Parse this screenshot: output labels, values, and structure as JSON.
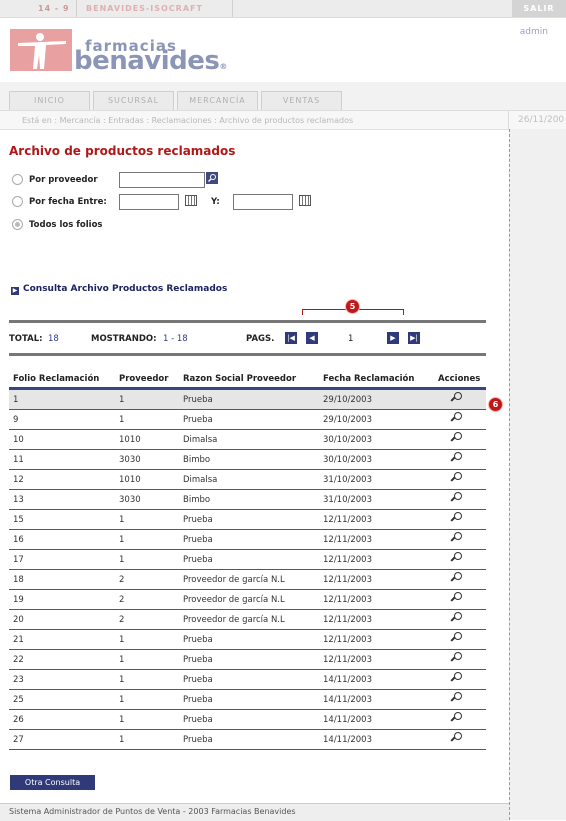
{
  "topbar": {
    "code": "14 - 9",
    "app_name": "BENAVIDES-ISOCRAFT",
    "logout": "SALIR"
  },
  "header": {
    "logo_small": "farmacias",
    "logo_big": "benavides",
    "logo_mark": "®",
    "user": "admin"
  },
  "nav": {
    "tabs": [
      "INICIO",
      "SUCURSAL",
      "MERCANCÍA",
      "VENTAS"
    ]
  },
  "breadcrumb": {
    "text": "Está en : Mercancía : Entradas : Reclamaciones : Archivo de productos reclamados",
    "date": "26/11/200"
  },
  "page": {
    "title": "Archivo de productos reclamados"
  },
  "filters": {
    "by_provider": "Por proveedor",
    "by_date": "Por fecha Entre:",
    "y_label": "Y:",
    "all": "Todos los folios",
    "provider_value": "",
    "date_from": "",
    "date_to": ""
  },
  "section": {
    "title": "Consulta Archivo Productos Reclamados"
  },
  "markers": {
    "m5": "5",
    "m6": "6"
  },
  "pagination": {
    "total_label": "TOTAL:",
    "total": "18",
    "showing_label": "MOSTRANDO:",
    "showing": "1 - 18",
    "pages_label": "PAGS.",
    "current_page": "1"
  },
  "table": {
    "headers": [
      "Folio Reclamación",
      "Proveedor",
      "Razon Social Proveedor",
      "Fecha Reclamación",
      "Acciones"
    ],
    "rows": [
      [
        "1",
        "1",
        "Prueba",
        "29/10/2003"
      ],
      [
        "9",
        "1",
        "Prueba",
        "29/10/2003"
      ],
      [
        "10",
        "1010",
        "Dimalsa",
        "30/10/2003"
      ],
      [
        "11",
        "3030",
        "Bimbo",
        "30/10/2003"
      ],
      [
        "12",
        "1010",
        "Dimalsa",
        "31/10/2003"
      ],
      [
        "13",
        "3030",
        "Bimbo",
        "31/10/2003"
      ],
      [
        "15",
        "1",
        "Prueba",
        "12/11/2003"
      ],
      [
        "16",
        "1",
        "Prueba",
        "12/11/2003"
      ],
      [
        "17",
        "1",
        "Prueba",
        "12/11/2003"
      ],
      [
        "18",
        "2",
        "Proveedor de garcía N.L",
        "12/11/2003"
      ],
      [
        "19",
        "2",
        "Proveedor de garcía N.L",
        "12/11/2003"
      ],
      [
        "20",
        "2",
        "Proveedor de garcía N.L",
        "12/11/2003"
      ],
      [
        "21",
        "1",
        "Prueba",
        "12/11/2003"
      ],
      [
        "22",
        "1",
        "Prueba",
        "12/11/2003"
      ],
      [
        "23",
        "1",
        "Prueba",
        "14/11/2003"
      ],
      [
        "25",
        "1",
        "Prueba",
        "14/11/2003"
      ],
      [
        "26",
        "1",
        "Prueba",
        "14/11/2003"
      ],
      [
        "27",
        "1",
        "Prueba",
        "14/11/2003"
      ]
    ]
  },
  "actions": {
    "other_query": "Otra Consulta"
  },
  "footer": {
    "text": "Sistema Administrador de Puntos de Venta - 2003 Farmacias Benavides"
  }
}
